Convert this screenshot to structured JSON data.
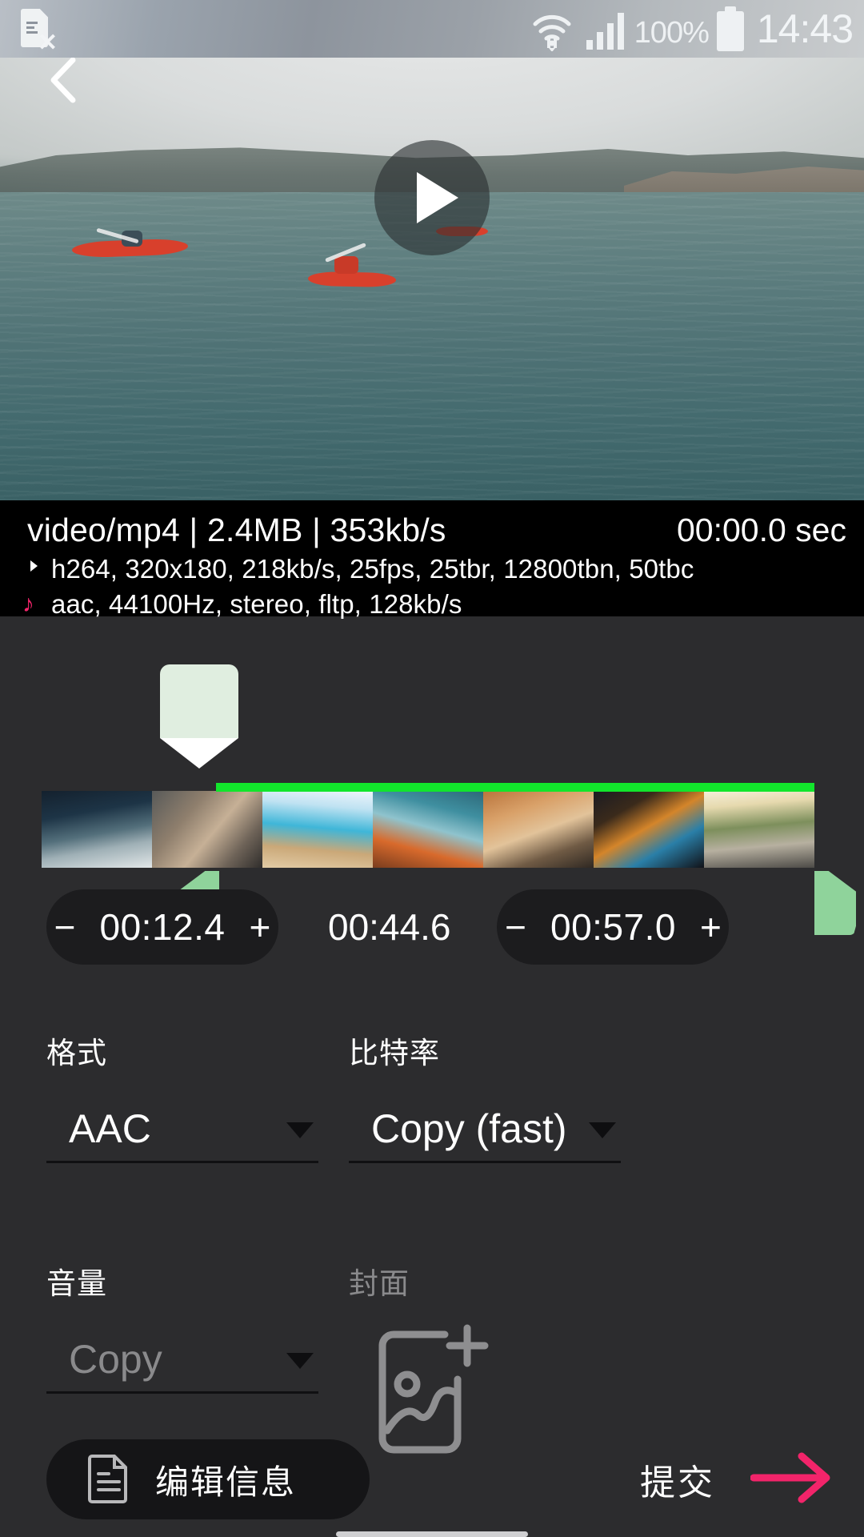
{
  "statusbar": {
    "sim_icon": "sim-card-error-icon",
    "wifi_icon": "wifi-icon",
    "signal_icon": "cellular-signal-icon",
    "battery_percent": "100%",
    "battery_icon": "battery-full-icon",
    "clock": "14:43"
  },
  "preview": {
    "back_icon": "back-chevron-icon",
    "play_icon": "play-icon"
  },
  "meta": {
    "title": "video/mp4 | 2.4MB | 353kb/s",
    "duration": "00:00.0 sec",
    "video_stream": "h264, 320x180, 218kb/s, 25fps, 25tbr, 12800tbn, 50tbc",
    "audio_stream": "aac, 44100Hz, stereo, fltp, 128kb/s",
    "video_glyph": "video-stream-icon",
    "audio_glyph": "♪"
  },
  "timeline": {
    "playhead_label": "playhead-marker",
    "left_handle": "trim-start-handle",
    "right_handle": "trim-end-handle",
    "selection_color": "#12e52c",
    "thumbnails": [
      "th1",
      "th2",
      "th3",
      "th4",
      "th5",
      "th6",
      "th7",
      "th8"
    ]
  },
  "time_controls": {
    "start": {
      "minus": "−",
      "value": "00:12.4",
      "plus": "+"
    },
    "total": "00:44.6",
    "end": {
      "minus": "−",
      "value": "00:57.0",
      "plus": "+"
    }
  },
  "fields": {
    "format": {
      "label": "格式",
      "value": "AAC",
      "caret": "chevron-down-icon"
    },
    "bitrate": {
      "label": "比特率",
      "value": "Copy (fast)",
      "caret": "chevron-down-icon"
    },
    "volume": {
      "label": "音量",
      "value": "Copy",
      "caret": "chevron-down-icon"
    },
    "cover": {
      "label": "封面",
      "icon": "add-image-icon"
    }
  },
  "bottom": {
    "edit_info": {
      "label": "编辑信息",
      "icon": "document-icon"
    },
    "submit": {
      "label": "提交",
      "icon": "arrow-right-icon",
      "accent": "#f2246a"
    }
  }
}
